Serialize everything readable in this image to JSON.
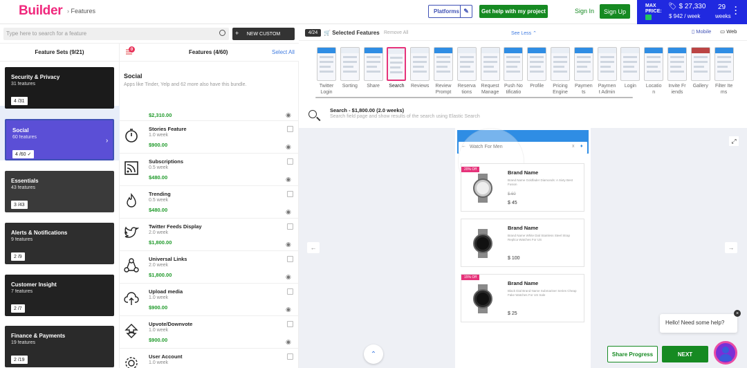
{
  "header": {
    "logo": "Builder",
    "breadcrumb": "Features",
    "platforms_label": "Platforms",
    "help_label": "Get help with my project",
    "signin_label": "Sign In",
    "signup_label": "Sign Up",
    "max_price_label": "MAX PRICE:",
    "max_price": "$ 27,330",
    "per_week": "$ 942 / week",
    "weeks_value": "29",
    "weeks_label": "weeks"
  },
  "left": {
    "search_placeholder": "Type here to search for a feature",
    "new_custom_label": "NEW CUSTOM",
    "feature_sets_title": "Feature Sets (9/21)",
    "features_title": "Features (4/60)",
    "select_all": "Select All",
    "cart_badge": "0",
    "bundle_title": "Social",
    "bundle_desc": "Apps like Tinder, Yelp and 62 more also have this bundle.",
    "sets": [
      {
        "title": "Security & Privacy",
        "sub": "31 features",
        "badge": "4 /31"
      },
      {
        "title": "Social",
        "sub": "60 features",
        "badge": "4 /60 ✓"
      },
      {
        "title": "Essentials",
        "sub": "43 features",
        "badge": "3 /43"
      },
      {
        "title": "Alerts & Notifications",
        "sub": "9 features",
        "badge": "2 /9"
      },
      {
        "title": "Customer Insight",
        "sub": "7 features",
        "badge": "2 /7"
      },
      {
        "title": "Finance & Payments",
        "sub": "19 features",
        "badge": "2 /19"
      }
    ],
    "partial_price": "$2,310.00",
    "features": [
      {
        "name": "Stories Feature",
        "weeks": "1.0 week",
        "price": "$900.00",
        "icon": "stopwatch-icon"
      },
      {
        "name": "Subscriptions",
        "weeks": "0.5 week",
        "price": "$480.00",
        "icon": "rss-icon"
      },
      {
        "name": "Trending",
        "weeks": "0.5 week",
        "price": "$480.00",
        "icon": "flame-icon"
      },
      {
        "name": "Twitter Feeds Display",
        "weeks": "2.0 week",
        "price": "$1,800.00",
        "icon": "twitter-icon"
      },
      {
        "name": "Universal Links",
        "weeks": "2.0 week",
        "price": "$1,800.00",
        "icon": "share-nodes-icon"
      },
      {
        "name": "Upload media",
        "weeks": "1.0 week",
        "price": "$900.00",
        "icon": "cloud-upload-icon"
      },
      {
        "name": "Upvote/Downvote",
        "weeks": "1.0 week",
        "price": "$900.00",
        "icon": "vote-arrows-icon"
      },
      {
        "name": "User Account",
        "weeks": "1.0 week",
        "price": "",
        "icon": "gear-icon"
      }
    ]
  },
  "right": {
    "selected_count": "4/24",
    "selected_label": "Selected Features",
    "remove_all": "Remove All",
    "see_less": "See Less",
    "mobile_label": "Mobile",
    "web_label": "Web",
    "strip_labels": [
      "Twitter Login",
      "Sorting",
      "Share",
      "Search",
      "Reviews",
      "Review Prompt",
      "Reservations",
      "Request Management",
      "Push Notifications",
      "Profile",
      "Pricing Engine",
      "Payments",
      "Payment Admin",
      "Login",
      "Location",
      "Invite Friends",
      "Gallery",
      "Filter Items"
    ],
    "strip_display": [
      "Twitter\nLogin",
      "Sorting",
      "Share",
      "Search",
      "Reviews",
      "Review\nPrompt",
      "Reserva\ntions",
      "Request\nManage",
      "Push No\ntificatio",
      "Profile",
      "Pricing\nEngine",
      "Paymen\nts",
      "Paymen\nt Admin",
      "Login",
      "Locatio\nn",
      "Invite Fr\niends",
      "Gallery",
      "Filter Ite\nms"
    ],
    "selected_index": 3,
    "info_title": "Search - $1,800.00 (2.0 weeks)",
    "info_desc": "Search field page and show results of the search using Elastic Search",
    "phone_search": "Watch For Men",
    "products": [
      {
        "brand": "Brand Name",
        "desc": "Brand Name Goldfader Diamonds: A Sixty Best Fusion",
        "old_price": "$ 60",
        "price": "$ 45",
        "tag": "20% Off"
      },
      {
        "brand": "Brand Name",
        "desc": "Brand Name White Dial Stainless Steel Strap Replica Watches For US",
        "old_price": "",
        "price": "$ 100",
        "tag": ""
      },
      {
        "brand": "Brand Name",
        "desc": "Black Dial Brand Name Submariner Series Cheap Fake Watches For US Sale",
        "old_price": "",
        "price": "$ 25",
        "tag": "15% Off"
      }
    ],
    "chat_text": "Hello! Need some help?",
    "share_progress": "Share Progress",
    "next_label": "NEXT"
  }
}
